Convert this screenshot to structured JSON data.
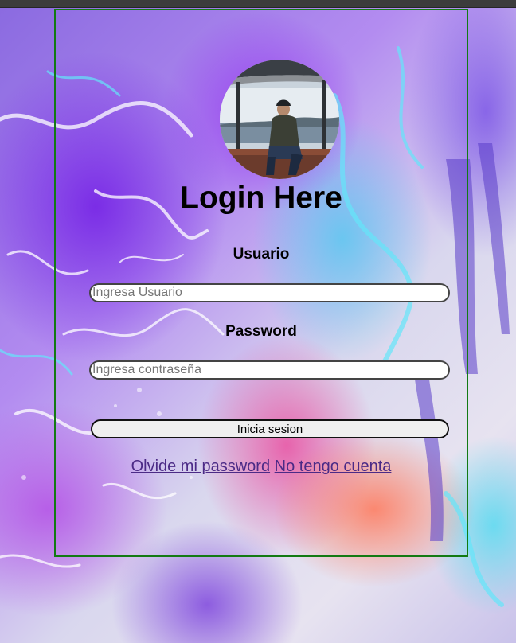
{
  "page": {
    "title": "Login Here"
  },
  "form": {
    "username_label": "Usuario",
    "username_placeholder": "Ingresa Usuario",
    "username_value": "",
    "password_label": "Password",
    "password_placeholder": "Ingresa contraseña",
    "password_value": "",
    "submit_label": "Inicia sesion"
  },
  "links": {
    "forgot_password": "Olvide mi password",
    "no_account": "No tengo cuenta"
  },
  "colors": {
    "card_border": "#137a13",
    "link": "#4b2a86"
  },
  "avatar": {
    "icon": "profile-photo-icon"
  }
}
